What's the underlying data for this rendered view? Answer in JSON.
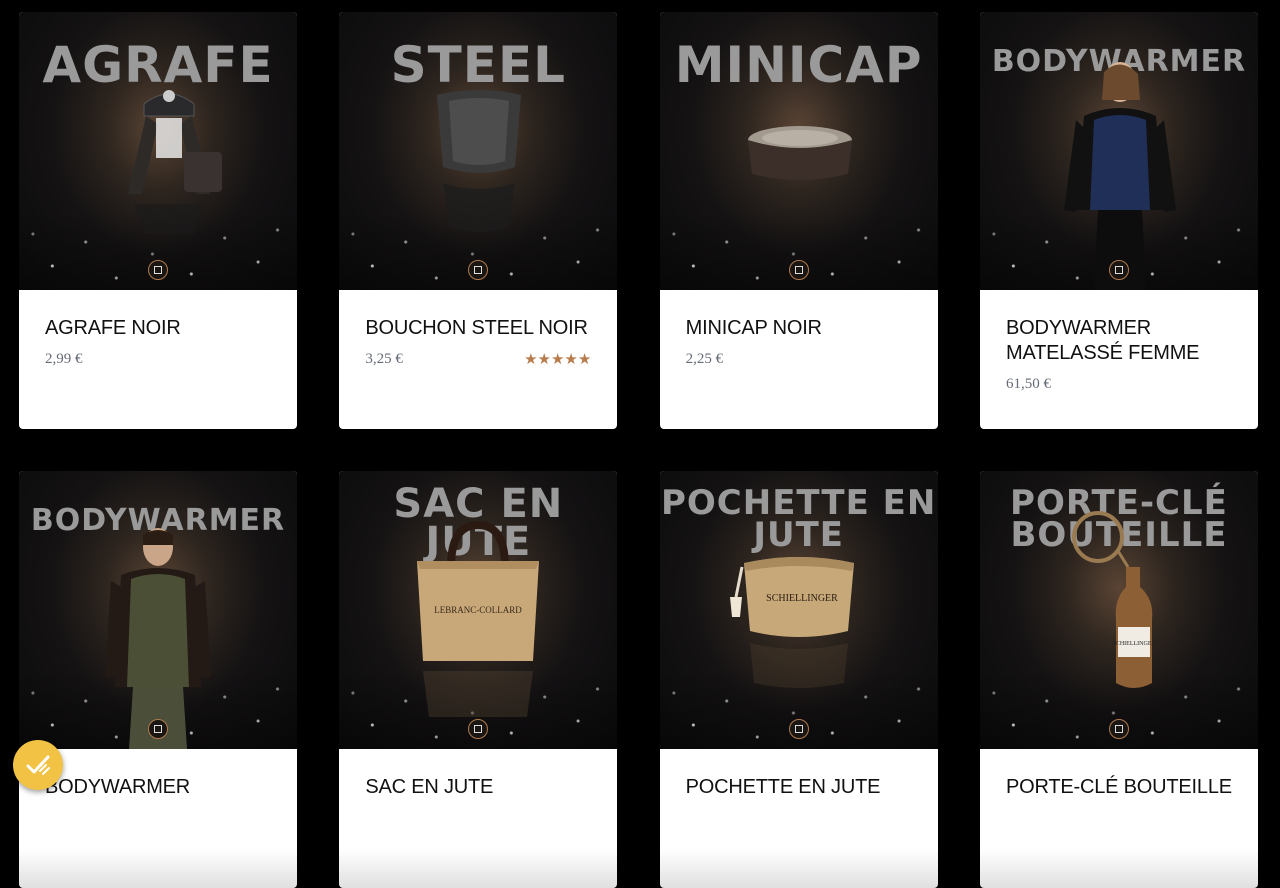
{
  "products": [
    {
      "hero": "AGRAFE",
      "name": "AGRAFE NOIR",
      "price": "2,99 €",
      "product_icon": "champagne-cage-icon"
    },
    {
      "hero": "STEEL",
      "name": "BOUCHON STEEL NOIR",
      "price": "3,25 €",
      "rating": "★★★★★",
      "product_icon": "bottle-stopper-icon"
    },
    {
      "hero": "MINICAP",
      "name": "MINICAP NOIR",
      "price": "2,25 €",
      "product_icon": "minicap-icon"
    },
    {
      "hero": "BODYWARMER",
      "name": "BODYWARMER MATELASSÉ FEMME",
      "price": "61,50 €",
      "product_icon": "woman-vest-icon"
    },
    {
      "hero": "BODYWARMER",
      "name": "BODYWARMER",
      "price": "",
      "product_icon": "man-vest-icon"
    },
    {
      "hero": "SAC EN JUTE",
      "name": "SAC EN JUTE",
      "price": "",
      "product_icon": "jute-bag-icon"
    },
    {
      "hero": "POCHETTE EN JUTE",
      "name": "POCHETTE EN JUTE",
      "price": "",
      "product_icon": "jute-pouch-icon"
    },
    {
      "hero": "PORTE-CLÉ BOUTEILLE",
      "name": "PORTE-CLÉ BOUTEILLE",
      "price": "",
      "product_icon": "bottle-keyring-icon"
    }
  ],
  "colors": {
    "page_bg": "#000000",
    "card_bg": "#ffffff",
    "accent_rating": "#b87c4c",
    "fab": "#f2c244",
    "price": "#666b78"
  },
  "fab": {
    "icon": "checklist-badge-icon"
  }
}
